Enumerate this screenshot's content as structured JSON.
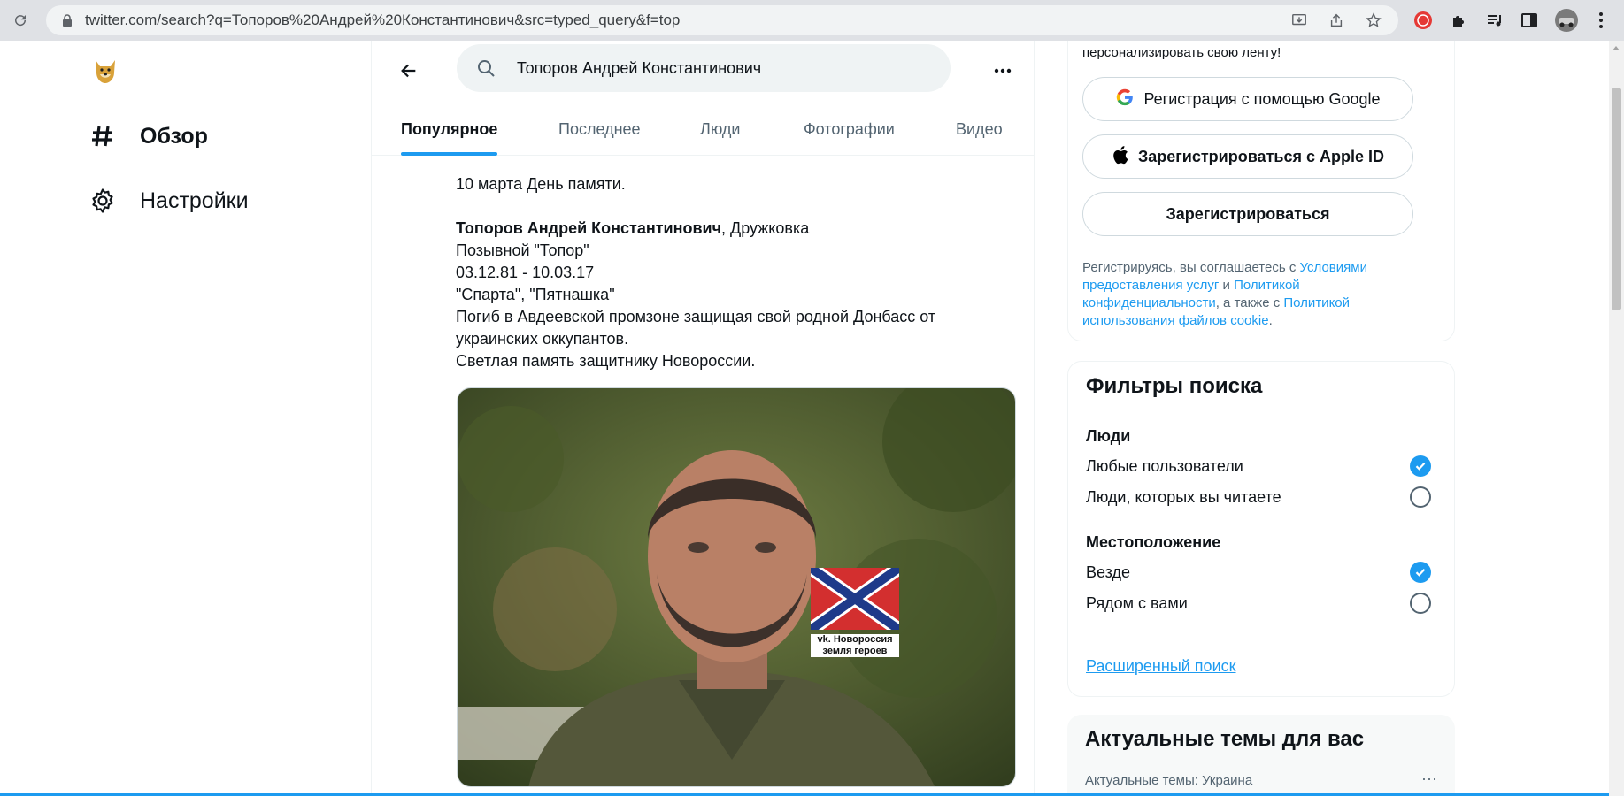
{
  "browser": {
    "url": "twitter.com/search?q=Топоров%20Андрей%20Константинович&src=typed_query&f=top"
  },
  "nav": {
    "items": [
      {
        "label": "Обзор",
        "icon": "hashtag-icon"
      },
      {
        "label": "Настройки",
        "icon": "gear-icon"
      }
    ]
  },
  "search": {
    "value": "Топоров Андрей Константинович"
  },
  "tabs": [
    "Популярное",
    "Последнее",
    "Люди",
    "Фотографии",
    "Видео"
  ],
  "tweet": {
    "line1": "10 марта День памяти.",
    "name_bold": "Топоров Андрей Константинович",
    "name_rest": ", Дружковка",
    "line3": "Позывной \"Топор\"",
    "line4": "03.12.81 - 10.03.17",
    "line5": "\"Спарта\", \"Пятнашка\"",
    "line6": "Погиб в Авдеевской промзоне защищая свой родной Донбасс от",
    "line7": "украинских оккупантов.",
    "line8": "Светлая память защитнику Новороссии.",
    "photo_caption1": "vk. Новороссия",
    "photo_caption2": "земля героев"
  },
  "signup": {
    "top_text": "персонализировать свою ленту!",
    "google": "Регистрация с помощью Google",
    "apple": "Зарегистрироваться с Apple ID",
    "plain": "Зарегистрироваться",
    "legal_1": "Регистрируясь, вы соглашаетесь с ",
    "legal_link1": "Условиями предоставления услуг",
    "legal_2": " и ",
    "legal_link2": "Политикой конфиденциальности",
    "legal_3": ", а также с ",
    "legal_link3": "Политикой использования файлов cookie",
    "legal_4": "."
  },
  "filters": {
    "title": "Фильтры поиска",
    "people_label": "Люди",
    "people_opt1": "Любые пользователи",
    "people_opt2": "Люди, которых вы читаете",
    "loc_label": "Местоположение",
    "loc_opt1": "Везде",
    "loc_opt2": "Рядом с вами",
    "advanced": "Расширенный поиск"
  },
  "trends": {
    "title": "Актуальные темы для вас",
    "sub": "Актуальные темы: Украина",
    "more": "···"
  },
  "colors": {
    "accent": "#1d9bf0",
    "text": "#0f1419",
    "muted": "#536471"
  }
}
